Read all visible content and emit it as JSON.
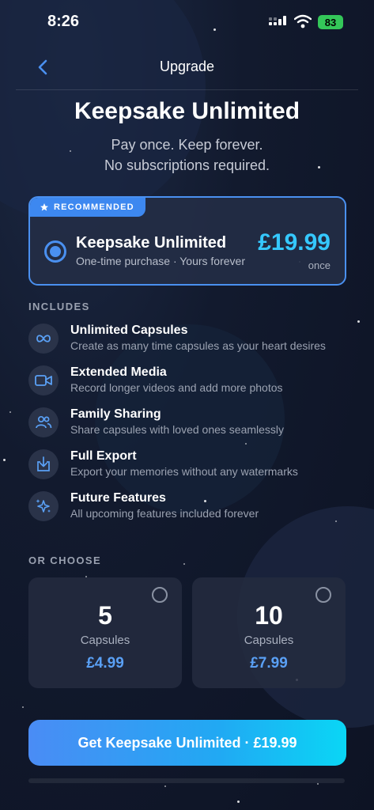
{
  "status_bar": {
    "time": "8:26",
    "battery": "83"
  },
  "nav": {
    "title": "Upgrade",
    "back_icon": "chevron-left-icon"
  },
  "hero": {
    "title": "Keepsake Unlimited",
    "subtitle_line1": "Pay once. Keep forever.",
    "subtitle_line2": "No subscriptions required."
  },
  "recommended": {
    "badge": "RECOMMENDED",
    "title": "Keepsake Unlimited",
    "subtitle": "One-time purchase · Yours forever",
    "price": "£19.99",
    "price_note": "once",
    "selected": true
  },
  "includes": {
    "label": "INCLUDES",
    "items": [
      {
        "icon": "infinity-icon",
        "title": "Unlimited Capsules",
        "desc": "Create as many time capsules as your heart desires"
      },
      {
        "icon": "video-camera-icon",
        "title": "Extended Media",
        "desc": "Record longer videos and add more photos"
      },
      {
        "icon": "people-icon",
        "title": "Family Sharing",
        "desc": "Share capsules with loved ones seamlessly"
      },
      {
        "icon": "download-icon",
        "title": "Full Export",
        "desc": "Export your memories without any watermarks"
      },
      {
        "icon": "sparkles-icon",
        "title": "Future Features",
        "desc": "All upcoming features included forever"
      }
    ]
  },
  "or_choose": {
    "label": "OR CHOOSE",
    "packs": [
      {
        "count": "5",
        "label": "Capsules",
        "price": "£4.99",
        "selected": false
      },
      {
        "count": "10",
        "label": "Capsules",
        "price": "£7.99",
        "selected": false
      }
    ]
  },
  "cta": {
    "label": "Get Keepsake Unlimited · £19.99"
  },
  "colors": {
    "accent": "#4a90f0",
    "price": "#35c8ff",
    "background": "#0f1628"
  }
}
